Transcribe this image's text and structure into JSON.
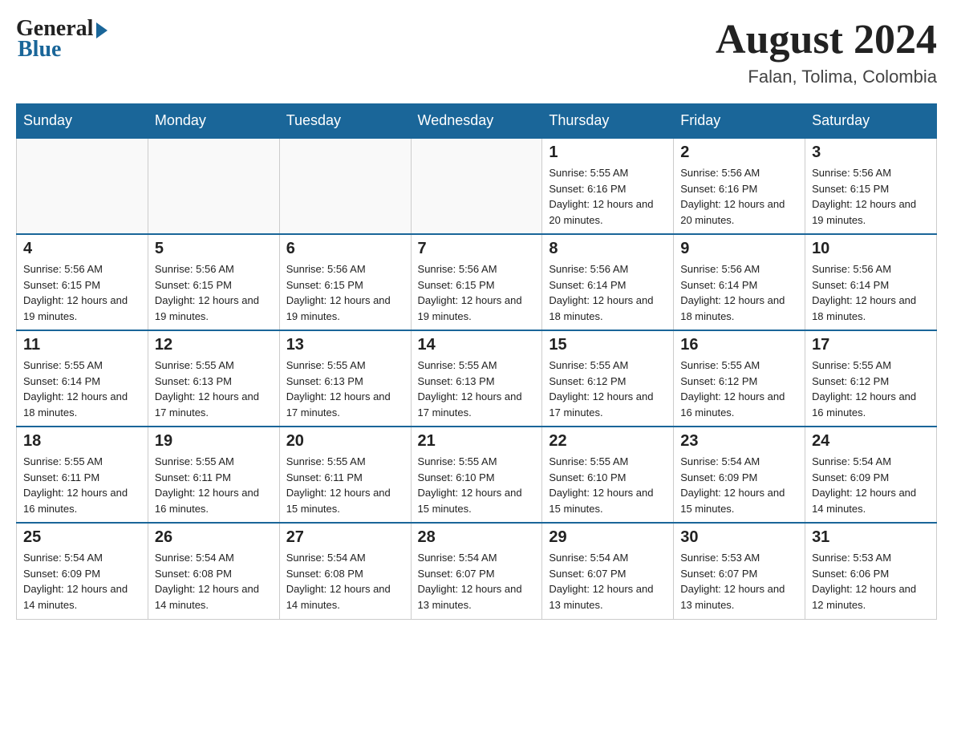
{
  "header": {
    "logo": {
      "general": "General",
      "blue": "Blue"
    },
    "month_title": "August 2024",
    "location": "Falan, Tolima, Colombia"
  },
  "days_of_week": [
    "Sunday",
    "Monday",
    "Tuesday",
    "Wednesday",
    "Thursday",
    "Friday",
    "Saturday"
  ],
  "weeks": [
    [
      {
        "day": "",
        "info": ""
      },
      {
        "day": "",
        "info": ""
      },
      {
        "day": "",
        "info": ""
      },
      {
        "day": "",
        "info": ""
      },
      {
        "day": "1",
        "info": "Sunrise: 5:55 AM\nSunset: 6:16 PM\nDaylight: 12 hours and 20 minutes."
      },
      {
        "day": "2",
        "info": "Sunrise: 5:56 AM\nSunset: 6:16 PM\nDaylight: 12 hours and 20 minutes."
      },
      {
        "day": "3",
        "info": "Sunrise: 5:56 AM\nSunset: 6:15 PM\nDaylight: 12 hours and 19 minutes."
      }
    ],
    [
      {
        "day": "4",
        "info": "Sunrise: 5:56 AM\nSunset: 6:15 PM\nDaylight: 12 hours and 19 minutes."
      },
      {
        "day": "5",
        "info": "Sunrise: 5:56 AM\nSunset: 6:15 PM\nDaylight: 12 hours and 19 minutes."
      },
      {
        "day": "6",
        "info": "Sunrise: 5:56 AM\nSunset: 6:15 PM\nDaylight: 12 hours and 19 minutes."
      },
      {
        "day": "7",
        "info": "Sunrise: 5:56 AM\nSunset: 6:15 PM\nDaylight: 12 hours and 19 minutes."
      },
      {
        "day": "8",
        "info": "Sunrise: 5:56 AM\nSunset: 6:14 PM\nDaylight: 12 hours and 18 minutes."
      },
      {
        "day": "9",
        "info": "Sunrise: 5:56 AM\nSunset: 6:14 PM\nDaylight: 12 hours and 18 minutes."
      },
      {
        "day": "10",
        "info": "Sunrise: 5:56 AM\nSunset: 6:14 PM\nDaylight: 12 hours and 18 minutes."
      }
    ],
    [
      {
        "day": "11",
        "info": "Sunrise: 5:55 AM\nSunset: 6:14 PM\nDaylight: 12 hours and 18 minutes."
      },
      {
        "day": "12",
        "info": "Sunrise: 5:55 AM\nSunset: 6:13 PM\nDaylight: 12 hours and 17 minutes."
      },
      {
        "day": "13",
        "info": "Sunrise: 5:55 AM\nSunset: 6:13 PM\nDaylight: 12 hours and 17 minutes."
      },
      {
        "day": "14",
        "info": "Sunrise: 5:55 AM\nSunset: 6:13 PM\nDaylight: 12 hours and 17 minutes."
      },
      {
        "day": "15",
        "info": "Sunrise: 5:55 AM\nSunset: 6:12 PM\nDaylight: 12 hours and 17 minutes."
      },
      {
        "day": "16",
        "info": "Sunrise: 5:55 AM\nSunset: 6:12 PM\nDaylight: 12 hours and 16 minutes."
      },
      {
        "day": "17",
        "info": "Sunrise: 5:55 AM\nSunset: 6:12 PM\nDaylight: 12 hours and 16 minutes."
      }
    ],
    [
      {
        "day": "18",
        "info": "Sunrise: 5:55 AM\nSunset: 6:11 PM\nDaylight: 12 hours and 16 minutes."
      },
      {
        "day": "19",
        "info": "Sunrise: 5:55 AM\nSunset: 6:11 PM\nDaylight: 12 hours and 16 minutes."
      },
      {
        "day": "20",
        "info": "Sunrise: 5:55 AM\nSunset: 6:11 PM\nDaylight: 12 hours and 15 minutes."
      },
      {
        "day": "21",
        "info": "Sunrise: 5:55 AM\nSunset: 6:10 PM\nDaylight: 12 hours and 15 minutes."
      },
      {
        "day": "22",
        "info": "Sunrise: 5:55 AM\nSunset: 6:10 PM\nDaylight: 12 hours and 15 minutes."
      },
      {
        "day": "23",
        "info": "Sunrise: 5:54 AM\nSunset: 6:09 PM\nDaylight: 12 hours and 15 minutes."
      },
      {
        "day": "24",
        "info": "Sunrise: 5:54 AM\nSunset: 6:09 PM\nDaylight: 12 hours and 14 minutes."
      }
    ],
    [
      {
        "day": "25",
        "info": "Sunrise: 5:54 AM\nSunset: 6:09 PM\nDaylight: 12 hours and 14 minutes."
      },
      {
        "day": "26",
        "info": "Sunrise: 5:54 AM\nSunset: 6:08 PM\nDaylight: 12 hours and 14 minutes."
      },
      {
        "day": "27",
        "info": "Sunrise: 5:54 AM\nSunset: 6:08 PM\nDaylight: 12 hours and 14 minutes."
      },
      {
        "day": "28",
        "info": "Sunrise: 5:54 AM\nSunset: 6:07 PM\nDaylight: 12 hours and 13 minutes."
      },
      {
        "day": "29",
        "info": "Sunrise: 5:54 AM\nSunset: 6:07 PM\nDaylight: 12 hours and 13 minutes."
      },
      {
        "day": "30",
        "info": "Sunrise: 5:53 AM\nSunset: 6:07 PM\nDaylight: 12 hours and 13 minutes."
      },
      {
        "day": "31",
        "info": "Sunrise: 5:53 AM\nSunset: 6:06 PM\nDaylight: 12 hours and 12 minutes."
      }
    ]
  ]
}
